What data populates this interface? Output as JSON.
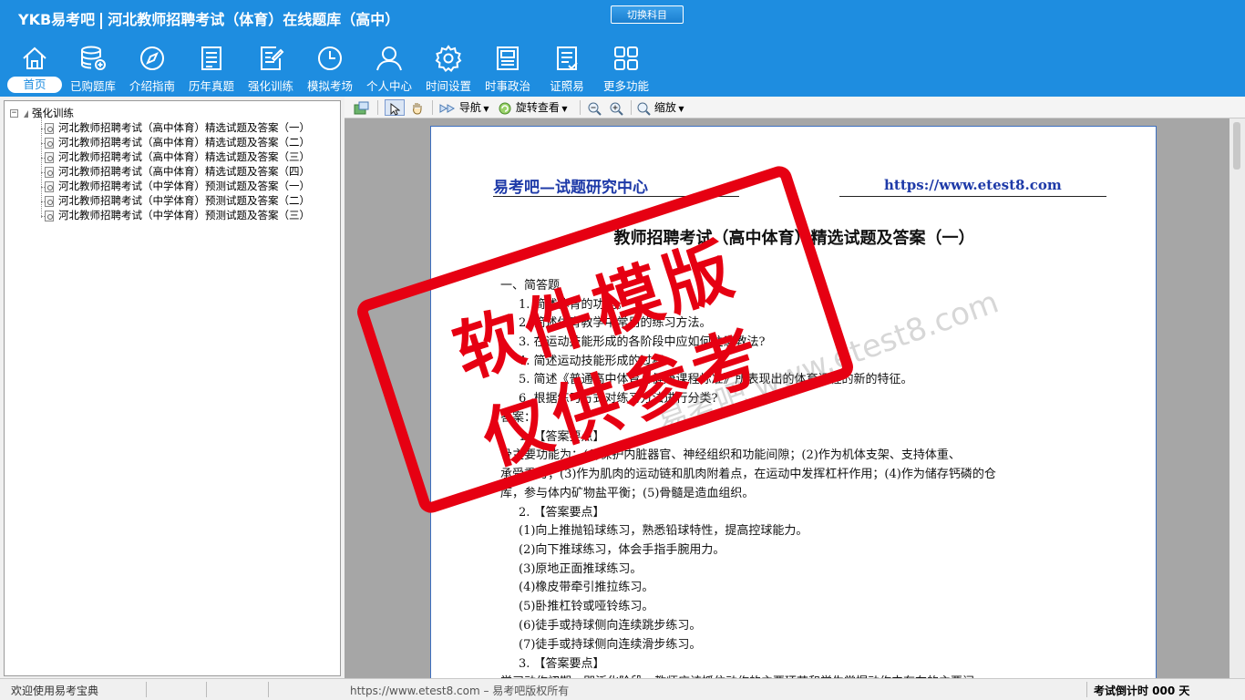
{
  "app": {
    "logo": "YKB易考吧",
    "title": "河北教师招聘考试（体育）在线题库（高中）",
    "switch_subject": "切换科目"
  },
  "nav": {
    "items": [
      {
        "label": "首页",
        "icon": "home-icon"
      },
      {
        "label": "已购题库",
        "icon": "database-icon"
      },
      {
        "label": "介绍指南",
        "icon": "compass-icon"
      },
      {
        "label": "历年真题",
        "icon": "document-list-icon"
      },
      {
        "label": "强化训练",
        "icon": "edit-document-icon"
      },
      {
        "label": "模拟考场",
        "icon": "clock-icon"
      },
      {
        "label": "个人中心",
        "icon": "user-icon"
      },
      {
        "label": "时间设置",
        "icon": "gear-icon"
      },
      {
        "label": "时事政治",
        "icon": "newspaper-icon"
      },
      {
        "label": "证照易",
        "icon": "checklist-icon"
      },
      {
        "label": "更多功能",
        "icon": "grid-icon"
      }
    ]
  },
  "tree": {
    "root": "强化训练",
    "items": [
      "河北教师招聘考试（高中体育）精选试题及答案（一）",
      "河北教师招聘考试（高中体育）精选试题及答案（二）",
      "河北教师招聘考试（高中体育）精选试题及答案（三）",
      "河北教师招聘考试（高中体育）精选试题及答案（四）",
      "河北教师招聘考试（中学体育）预测试题及答案（一）",
      "河北教师招聘考试（中学体育）预测试题及答案（二）",
      "河北教师招聘考试（中学体育）预测试题及答案（三）"
    ]
  },
  "toolbar": {
    "nav_label": "导航",
    "rotate_label": "旋转查看",
    "zoom_label": "缩放"
  },
  "document": {
    "header_left": "易考吧—试题研究中心",
    "header_right": "https://www.etest8.com",
    "title": "教师招聘考试（高中体育）精选试题及答案（一）",
    "lines": [
      "一、简答题",
      "1. 简述体育的功能。",
      "2. 简述体育教学中常用的练习方法。",
      "3. 在运动技能形成的各阶段中应如何注意教法?",
      "4. 简述运动技能形成的过程",
      "5. 简述《普通高中体育与健康课程标准》所表现出的体育课程的新的特征。",
      "6. 根据练习方式对练习方法进行分类?",
      "答案：",
      "1. 【答案要点】",
      "骨主要功能为：(1)保护内脏器官、神经组织和功能间隙；(2)作为机体支架、支持体重、",
      "承受重力；(3)作为肌肉的运动链和肌肉附着点，在运动中发挥杠杆作用；(4)作为储存钙磷的仓",
      "库，参与体内矿物盐平衡；(5)骨髓是造血组织。",
      "2. 【答案要点】",
      "(1)向上推抛铅球练习，熟悉铅球特性，提高控球能力。",
      "(2)向下推球练习，体会手指手腕用力。",
      "(3)原地正面推球练习。",
      "(4)橡皮带牵引推拉练习。",
      "(5)卧推杠铃或哑铃练习。",
      "(6)徒手或持球侧向连续跳步练习。",
      "(7)徒手或持球侧向连续滑步练习。",
      "3. 【答案要点】",
      "学习动作初期，即泛化阶段，教师应该抓住动作的主要环节和学生掌握动作中存在的主要问"
    ],
    "watermark": "易考吧 www.etest8.com",
    "stamp_line1": "软件模版",
    "stamp_line2": "仅供参考"
  },
  "status": {
    "welcome": "欢迎使用易考宝典",
    "copyright": "https://www.etest8.com – 易考吧版权所有",
    "countdown": "考试倒计时 000 天"
  },
  "colors": {
    "header_bg": "#1e8de0",
    "stamp_red": "#e60012",
    "doc_blue": "#1e3aa8"
  }
}
